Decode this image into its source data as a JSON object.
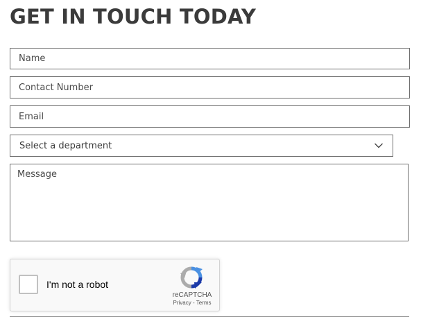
{
  "form": {
    "title": "GET IN TOUCH TODAY",
    "name_placeholder": "Name",
    "contact_placeholder": "Contact Number",
    "email_placeholder": "Email",
    "department_selected": "Select a department",
    "message_placeholder": "Message"
  },
  "recaptcha": {
    "checkbox_label": "I'm not a robot",
    "brand": "reCAPTCHA",
    "privacy_link": "Privacy",
    "separator": " - ",
    "terms_link": "Terms",
    "icon": "recaptcha-logo-icon",
    "colors": {
      "blue": "#4a90e2",
      "dark_blue": "#1c3aa9",
      "gray": "#abababab"
    }
  },
  "colors": {
    "title": "#3b3b3b",
    "field_border": "#6f6f6f",
    "checkbox_border": "#c1c1c1"
  }
}
